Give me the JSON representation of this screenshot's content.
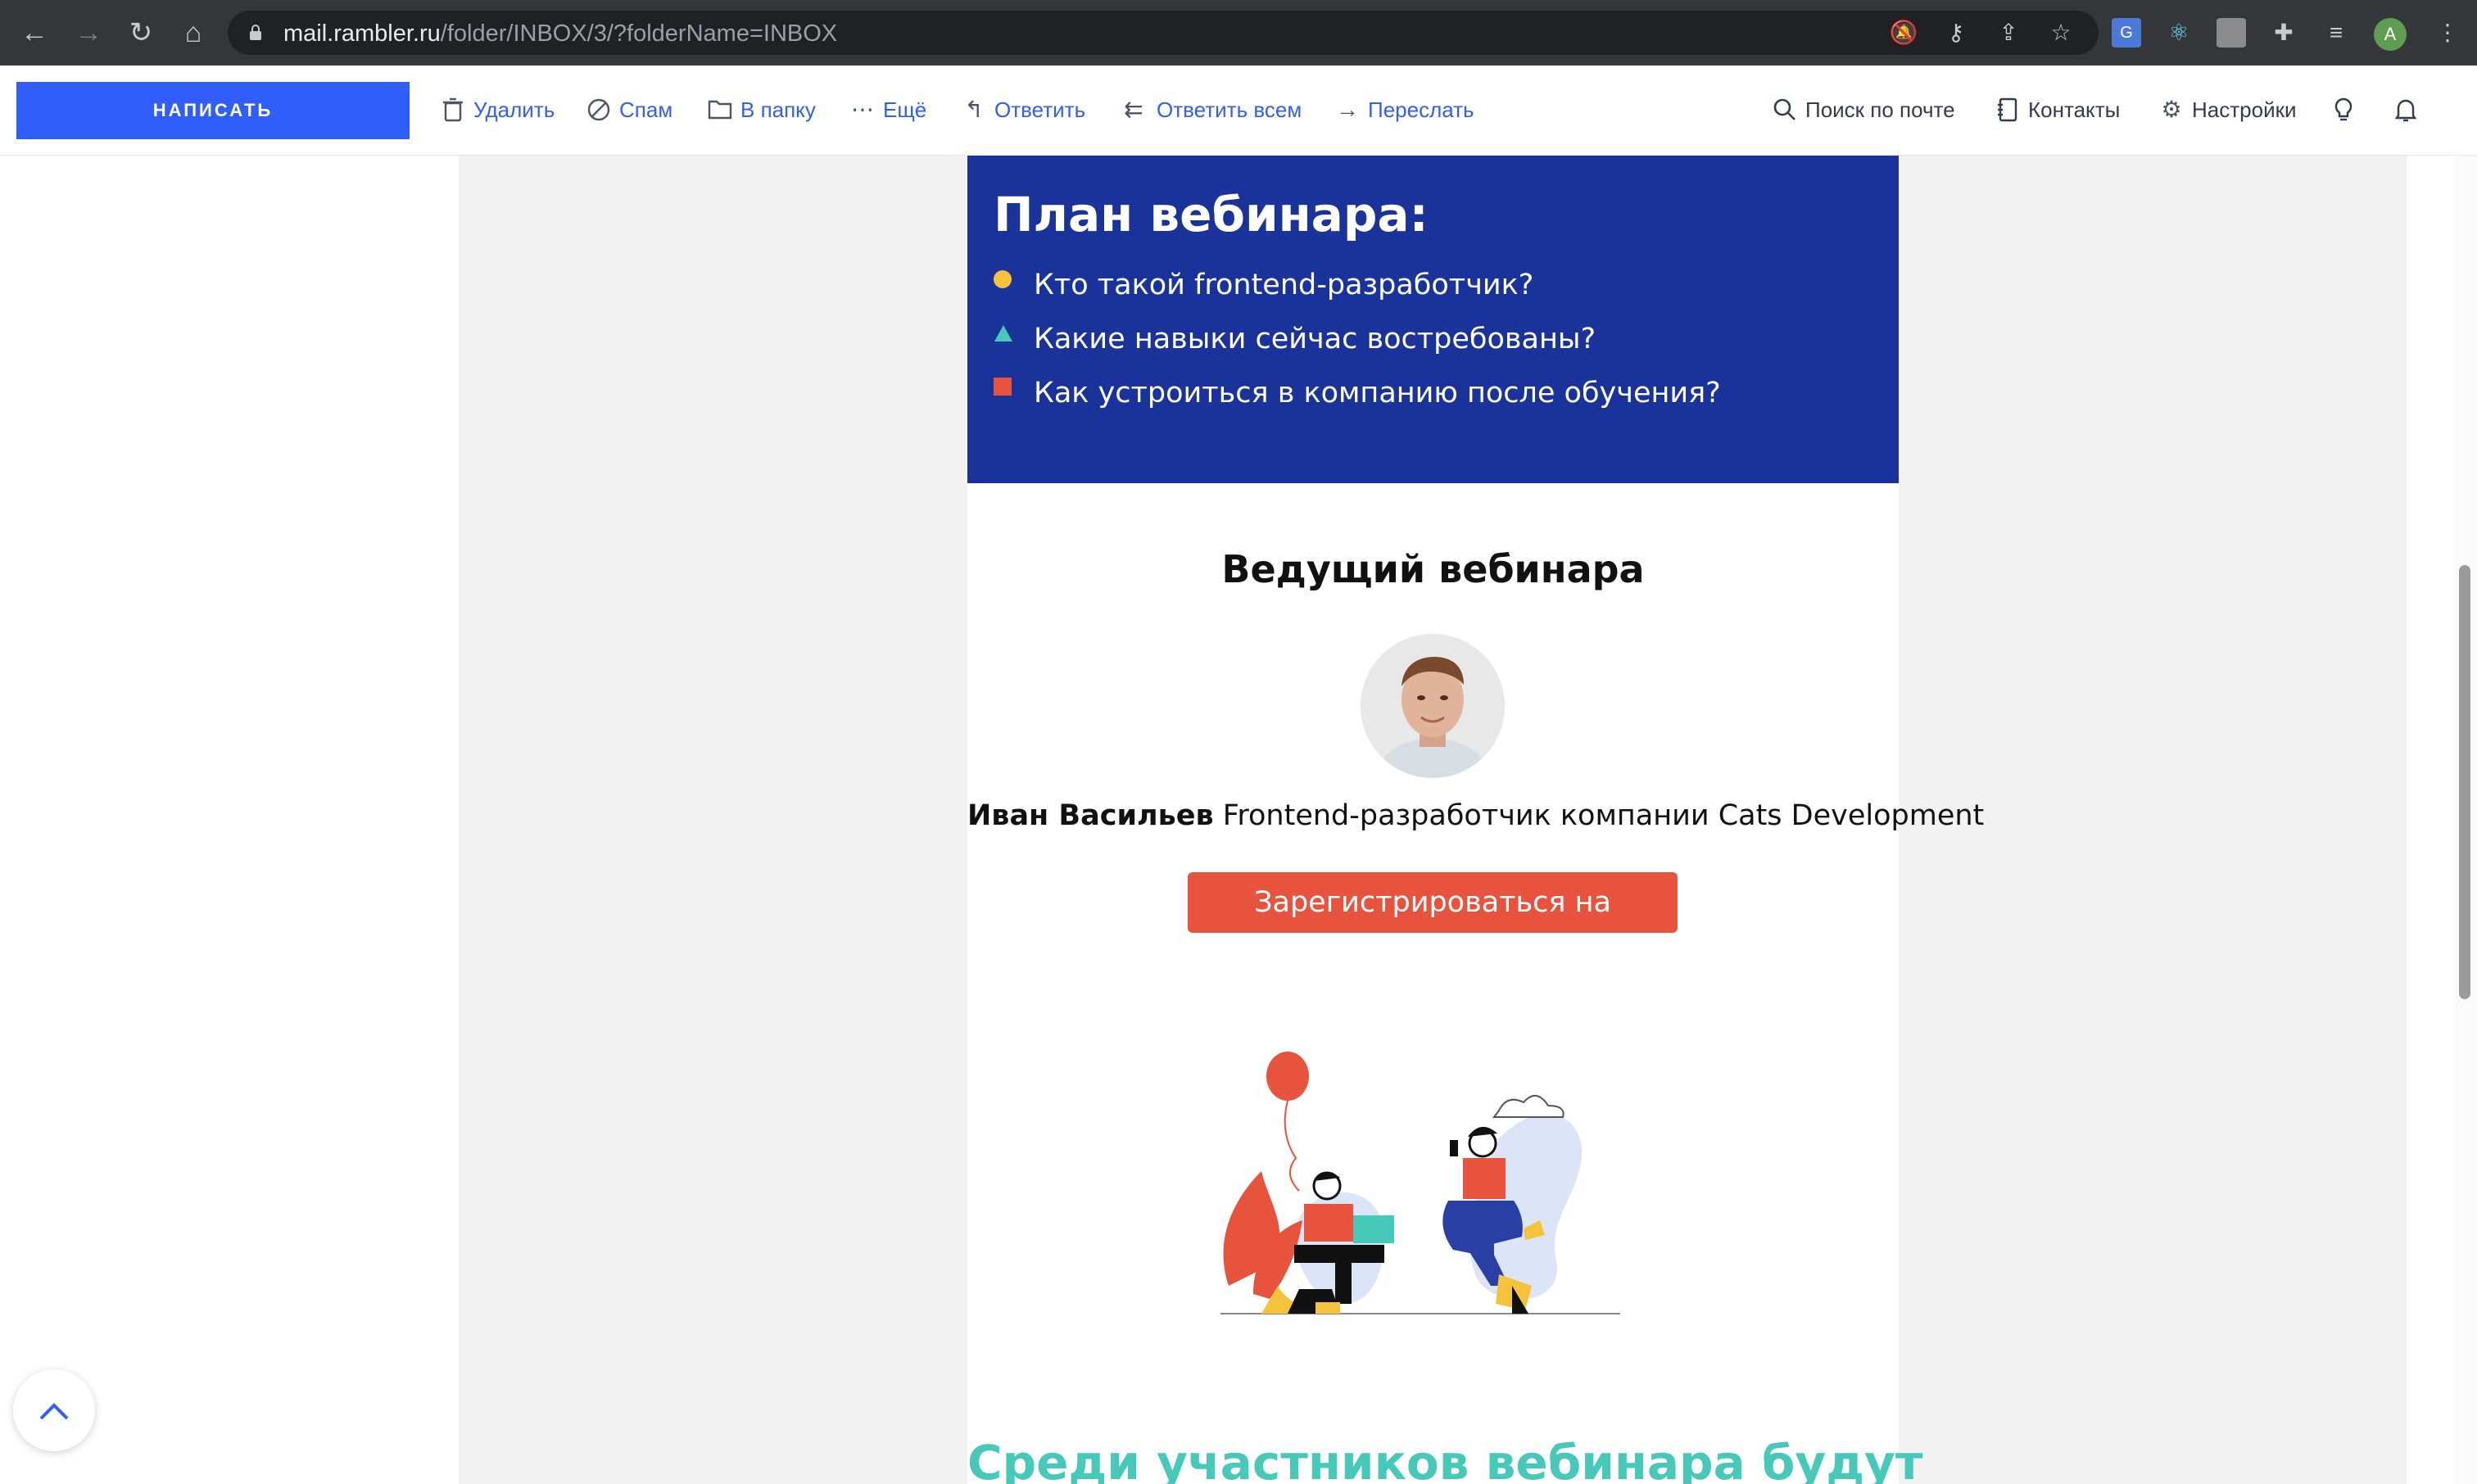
{
  "browser": {
    "url_host": "mail.rambler.ru",
    "url_path": "/folder/INBOX/3/?folderName=INBOX",
    "avatar_letter": "A"
  },
  "toolbar": {
    "compose": "НАПИСАТЬ",
    "delete": "Удалить",
    "spam": "Спам",
    "to_folder": "В папку",
    "more": "Ещё",
    "reply": "Ответить",
    "reply_all": "Ответить всем",
    "forward": "Переслать",
    "search": "Поиск по почте",
    "contacts": "Контакты",
    "settings": "Настройки"
  },
  "email": {
    "plan_title": "План вебинара:",
    "plan_items": [
      {
        "text": "Кто такой frontend-разработчик?",
        "marker": "circle",
        "color": "#f5c33b"
      },
      {
        "text": "Какие навыки сейчас востребованы?",
        "marker": "triangle",
        "color": "#46c9b8"
      },
      {
        "text": "Как устроиться в компанию после обучения?",
        "marker": "square",
        "color": "#e8533e"
      }
    ],
    "host_title": "Ведущий вебинара",
    "host_name": "Иван Васильев",
    "host_role": "Frontend-разработчик компании Cats Development",
    "register_button": "Зарегистрироваться на вебинар",
    "participants_heading": "Среди участников вебинара будут"
  },
  "colors": {
    "accent": "#315efb",
    "plan_bg": "#19339a",
    "button": "#e8533e",
    "teal": "#46c9b8"
  }
}
